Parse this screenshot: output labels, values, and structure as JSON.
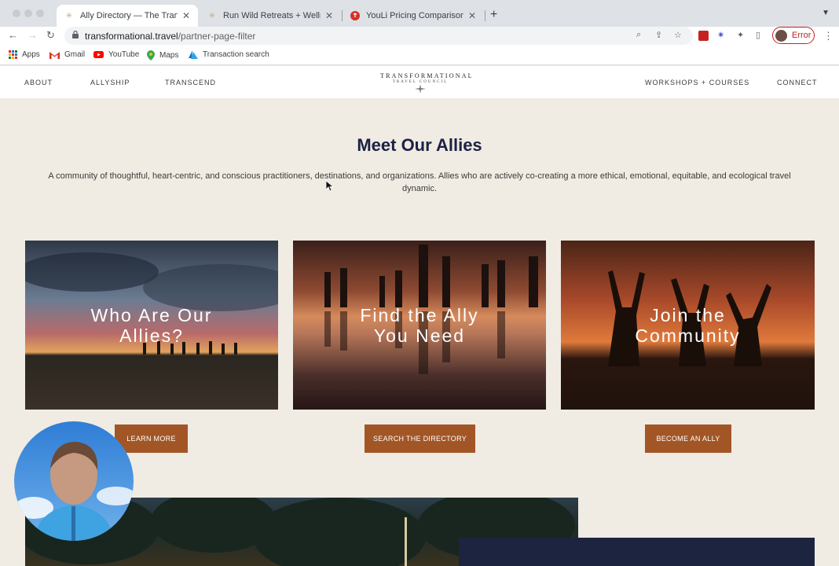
{
  "browser": {
    "tabs": [
      {
        "label": "Ally Directory — The Transform",
        "active": true
      },
      {
        "label": "Run Wild Retreats + Wellness –",
        "active": false
      },
      {
        "label": "YouLi Pricing Comparison",
        "active": false
      }
    ],
    "url_host": "transformational.travel",
    "url_path": "/partner-page-filter",
    "profile_label": "Error",
    "bookmarks": [
      "Apps",
      "Gmail",
      "YouTube",
      "Maps",
      "Transaction search"
    ]
  },
  "site": {
    "nav_left": [
      "ABOUT",
      "ALLYSHIP",
      "TRANSCEND"
    ],
    "nav_right": [
      "WORKSHOPS + COURSES",
      "CONNECT"
    ],
    "logo_line1": "TRANSFORMATIONAL",
    "logo_line2": "TRAVEL COUNCIL"
  },
  "main": {
    "heading": "Meet Our Allies",
    "intro": "A community of thoughtful, heart-centric, and conscious practitioners, destinations, and organizations. Allies who are actively co-creating a more ethical, emotional, equitable, and ecological travel dynamic.",
    "cards": [
      {
        "title_l1": "Who Are Our",
        "title_l2": "Allies?",
        "cta": "LEARN MORE"
      },
      {
        "title_l1": "Find the Ally",
        "title_l2": "You Need",
        "cta": "SEARCH THE DIRECTORY"
      },
      {
        "title_l1": "Join the",
        "title_l2": "Community",
        "cta": "BECOME AN ALLY"
      }
    ]
  },
  "colors": {
    "accent": "#a25626",
    "heading": "#1b2243",
    "page_bg": "#f0ebe3",
    "profile_error": "#c5221f"
  }
}
